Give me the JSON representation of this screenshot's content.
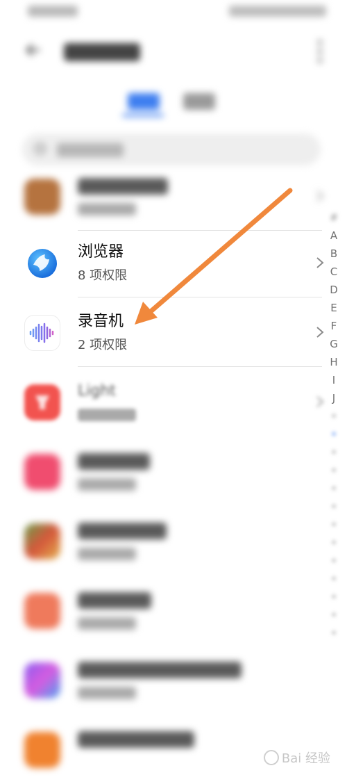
{
  "apps": [
    {
      "name": "浏览器",
      "permissions": "8 项权限"
    },
    {
      "name": "录音机",
      "permissions": "2 项权限"
    },
    {
      "name": "Light"
    }
  ],
  "index_letters": [
    "#",
    "A",
    "B",
    "C",
    "D",
    "E",
    "F",
    "G",
    "H",
    "I",
    "J"
  ],
  "colors": {
    "accent": "#3f7ff0",
    "arrow": "#f0883c",
    "browser_icon": "#1f87e8",
    "recorder_bars": "#7b5cf0",
    "light_icon": "#f2534f"
  },
  "icons": {
    "back": "arrow-left-icon",
    "more": "more-vertical-icon",
    "search": "search-icon",
    "chevron": "chevron-right-icon"
  },
  "watermark": "Bai 经验"
}
